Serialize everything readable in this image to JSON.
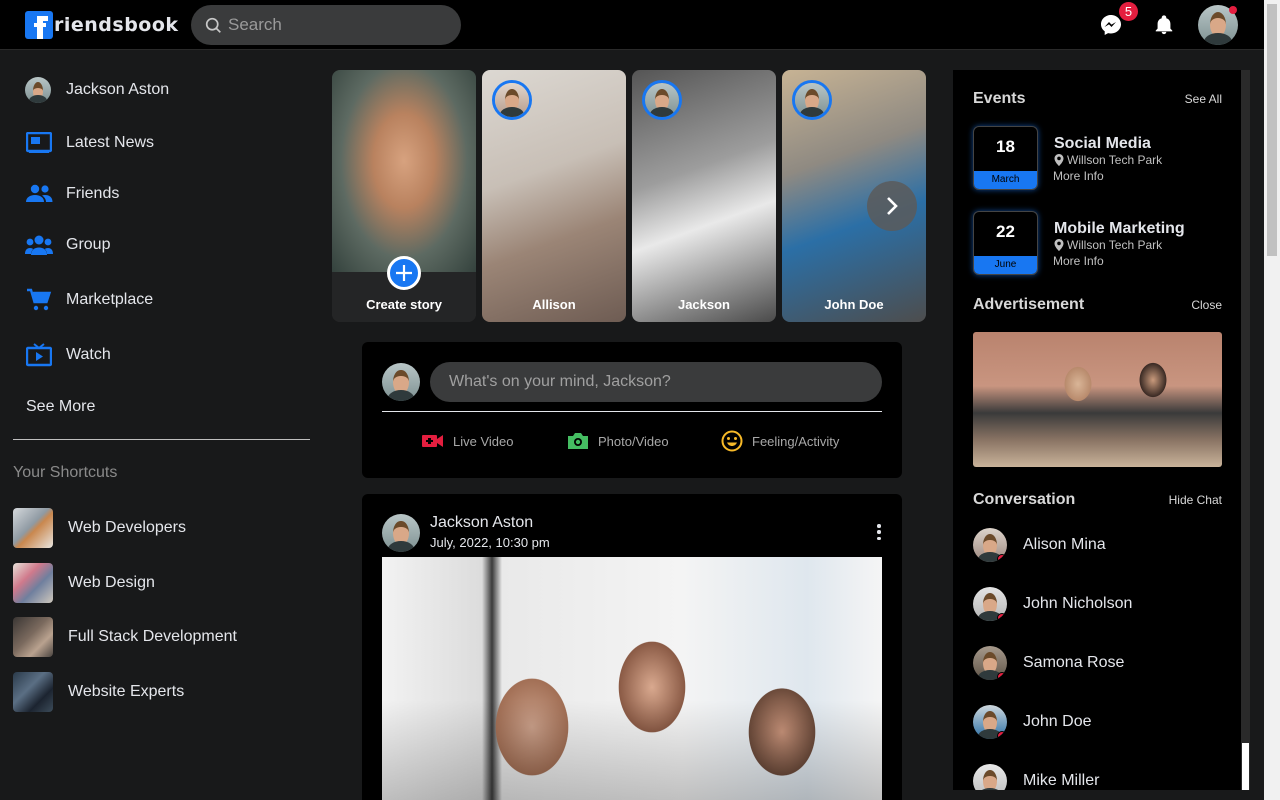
{
  "nav": {
    "logo_text": "riendsbook",
    "search_placeholder": "Search",
    "messenger_badge": "5"
  },
  "sidebar": {
    "profile_name": "Jackson Aston",
    "items": [
      {
        "label": "Latest News",
        "icon": "news-icon"
      },
      {
        "label": "Friends",
        "icon": "friends-icon"
      },
      {
        "label": "Group",
        "icon": "group-icon"
      },
      {
        "label": "Marketplace",
        "icon": "cart-icon"
      },
      {
        "label": "Watch",
        "icon": "tv-icon"
      }
    ],
    "see_more": "See More",
    "shortcuts_title": "Your Shortcuts",
    "shortcuts": [
      {
        "label": "Web Developers"
      },
      {
        "label": "Web Design"
      },
      {
        "label": "Full Stack Development"
      },
      {
        "label": "Website Experts"
      }
    ]
  },
  "stories": [
    {
      "label": "Create story"
    },
    {
      "label": "Allison"
    },
    {
      "label": "Jackson"
    },
    {
      "label": "John Doe"
    }
  ],
  "composer": {
    "placeholder": "What's on your mind, Jackson?",
    "actions": [
      {
        "label": "Live Video",
        "color": "#e41e3f"
      },
      {
        "label": "Photo/Video",
        "color": "#45bd62"
      },
      {
        "label": "Feeling/Activity",
        "color": "#f7b928"
      }
    ]
  },
  "post": {
    "author": "Jackson Aston",
    "date": "July, 2022, 10:30 pm"
  },
  "right": {
    "events_title": "Events",
    "events_link": "See All",
    "events": [
      {
        "day": "18",
        "month": "March",
        "title": "Social Media",
        "location": "Willson Tech Park",
        "more": "More Info"
      },
      {
        "day": "22",
        "month": "June",
        "title": "Mobile Marketing",
        "location": "Willson Tech Park",
        "more": "More Info"
      }
    ],
    "ad_title": "Advertisement",
    "ad_link": "Close",
    "conv_title": "Conversation",
    "conv_link": "Hide Chat",
    "contacts": [
      {
        "name": "Alison Mina"
      },
      {
        "name": "John Nicholson"
      },
      {
        "name": "Samona Rose"
      },
      {
        "name": "John Doe"
      },
      {
        "name": "Mike Miller"
      }
    ]
  },
  "colors": {
    "accent": "#1877f2",
    "background": "#18191a",
    "panel": "#000000",
    "notification": "#e41e3f"
  }
}
